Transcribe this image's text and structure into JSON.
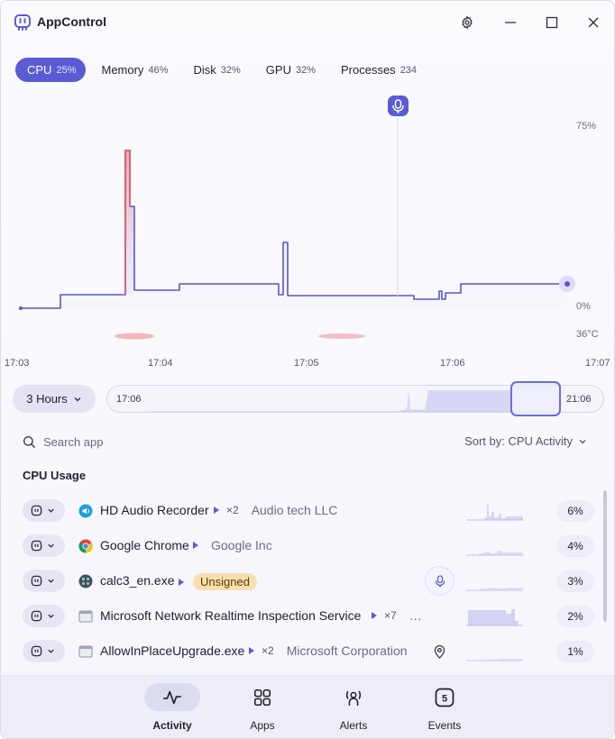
{
  "app": {
    "title": "AppControl"
  },
  "tabs": [
    {
      "label": "CPU",
      "value": "25%",
      "active": true
    },
    {
      "label": "Memory",
      "value": "46%"
    },
    {
      "label": "Disk",
      "value": "32%"
    },
    {
      "label": "GPU",
      "value": "32%"
    },
    {
      "label": "Processes",
      "value": "234"
    }
  ],
  "chart": {
    "y_top_label": "75%",
    "y_bottom_label": "0%",
    "temp_label": "36°C",
    "time_labels": [
      "17:03",
      "17:04",
      "17:05",
      "17:06",
      "17:07"
    ]
  },
  "range": {
    "hours_label": "3 Hours",
    "start_label": "17:06",
    "end_label": "21:06"
  },
  "search": {
    "placeholder": "Search app"
  },
  "sort": {
    "label": "Sort by: CPU Activity"
  },
  "section_title": "CPU Usage",
  "processes": [
    {
      "name": "HD Audio Recorder",
      "count": "×2",
      "vendor": "Audio tech LLC",
      "cpu": "6%"
    },
    {
      "name": "Google Chrome",
      "vendor": "Google Inc",
      "cpu": "4%"
    },
    {
      "name": "calc3_en.exe",
      "badge": "Unsigned",
      "cpu": "3%"
    },
    {
      "name": "Microsoft Network Realtime Inspection Service",
      "count": "×7",
      "vendor": "…",
      "cpu": "2%"
    },
    {
      "name": "AllowInPlaceUpgrade.exe",
      "count": "×2",
      "vendor": "Microsoft Corporation",
      "cpu": "1%"
    }
  ],
  "nav": [
    {
      "label": "Activity",
      "active": true
    },
    {
      "label": "Apps"
    },
    {
      "label": "Alerts"
    },
    {
      "label": "Events",
      "badge": "5"
    }
  ],
  "colors": {
    "accent": "#5b5bd6",
    "spike": "#e35d6a",
    "badge_bg": "#f8dfb0"
  }
}
